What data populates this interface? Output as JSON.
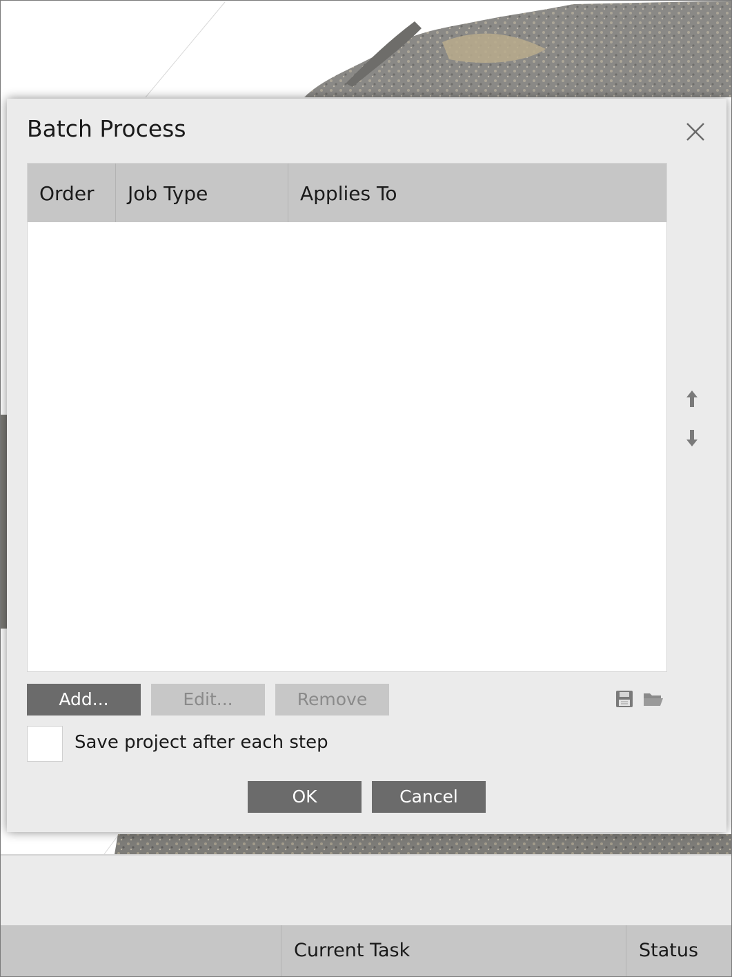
{
  "dialog": {
    "title": "Batch Process",
    "table": {
      "columns": [
        "Order",
        "Job Type",
        "Applies To"
      ],
      "rows": []
    },
    "buttons": {
      "add": "Add...",
      "edit": "Edit...",
      "remove": "Remove",
      "ok": "OK",
      "cancel": "Cancel"
    },
    "checkbox": {
      "label": "Save project after each step",
      "checked": false
    },
    "icons": [
      "close-icon",
      "arrow-up-icon",
      "arrow-down-icon",
      "save-icon",
      "folder-open-icon"
    ]
  },
  "task_panel": {
    "columns": [
      "",
      "Current Task",
      "Status"
    ]
  },
  "colors": {
    "dialog_bg": "#ebebeb",
    "header_bg": "#c6c6c6",
    "primary_button": "#6b6b6b",
    "disabled_button": "#c7c7c7"
  }
}
